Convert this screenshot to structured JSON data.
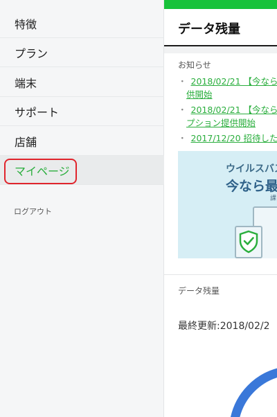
{
  "sidebar": {
    "items": [
      {
        "label": "特徴"
      },
      {
        "label": "プラン"
      },
      {
        "label": "端末"
      },
      {
        "label": "サポート"
      },
      {
        "label": "店舗"
      },
      {
        "label": "マイページ"
      }
    ],
    "logout_label": "ログアウト"
  },
  "main": {
    "title": "データ残量",
    "notices_header": "お知らせ",
    "notices": [
      {
        "text": "2018/02/21 【今なら",
        "cont": "供開始"
      },
      {
        "text": "2018/02/21 【今なら",
        "cont": "プション提供開始"
      },
      {
        "text": "2017/12/20 招待した"
      }
    ],
    "banner": {
      "line1": "ウイルスバス",
      "line2": "今なら最",
      "small": "課"
    },
    "data_section_label": "データ残量",
    "last_updated": "最終更新:2018/02/2"
  },
  "colors": {
    "accent": "#2aae3d",
    "top_bar": "#17c23a",
    "highlight": "#e0242c",
    "gauge": "#3a78d9"
  }
}
